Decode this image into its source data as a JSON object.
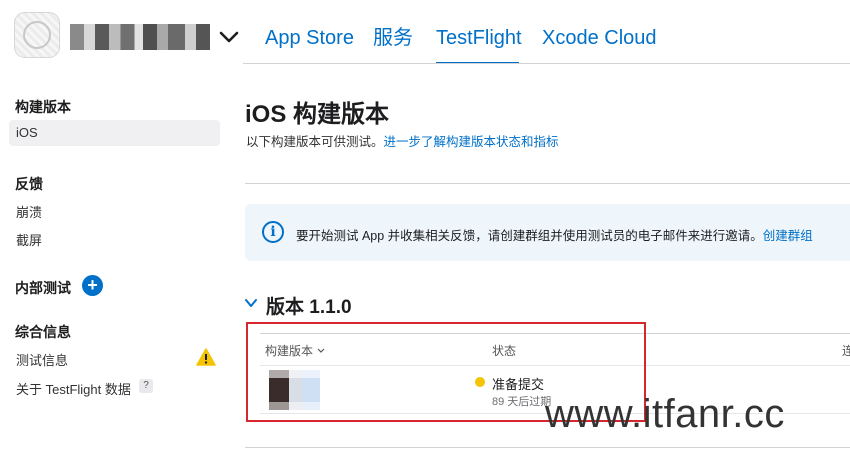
{
  "header": {
    "tabs": [
      {
        "label": "App Store",
        "active": false
      },
      {
        "label": "服务",
        "active": false
      },
      {
        "label": "TestFlight",
        "active": true
      },
      {
        "label": "Xcode Cloud",
        "active": false
      }
    ]
  },
  "sidebar": {
    "sections": [
      {
        "heading": "构建版本",
        "items": [
          {
            "label": "iOS",
            "selected": true
          }
        ]
      },
      {
        "heading": "反馈",
        "items": [
          {
            "label": "崩溃"
          },
          {
            "label": "截屏"
          }
        ]
      },
      {
        "heading": "内部测试",
        "items": []
      },
      {
        "heading": "综合信息",
        "items": [
          {
            "label": "测试信息"
          },
          {
            "label": "关于 TestFlight 数据"
          }
        ]
      }
    ],
    "qmark": "?"
  },
  "main": {
    "title": "iOS 构建版本",
    "subtitle": "以下构建版本可供测试。",
    "subtitle_link": "进一步了解构建版本状态和指标",
    "info_text": "要开始测试 App 并收集相关反馈，请创建群组并使用测试员的电子邮件来进行邀请。",
    "info_link": "创建群组",
    "version_title": "版本 1.1.0",
    "columns": {
      "build": "构建版本",
      "status": "状态",
      "cut": "连"
    },
    "row": {
      "status": "准备提交",
      "expires": "89 天后过期"
    }
  },
  "watermark": "www.itfanr.cc",
  "colors": {
    "accent": "#0070c9",
    "status_dot": "#f5c400",
    "highlight_box": "#d6262e",
    "warning": "#f5c400"
  }
}
